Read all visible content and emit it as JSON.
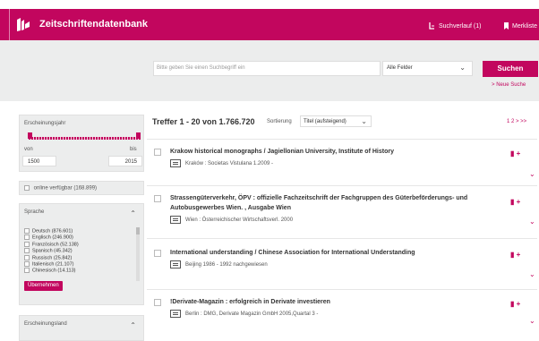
{
  "header": {
    "title": "Zeitschriftendatenbank",
    "history_label": "Suchverlauf (1)",
    "merkliste_label": "Merkliste"
  },
  "search": {
    "placeholder": "Bitte geben Sie einen Suchbegriff ein",
    "field_selected": "Alle Felder",
    "button_label": "Suchen",
    "new_search_label": "Neue Suche"
  },
  "filters": {
    "year": {
      "title": "Erscheinungsjahr",
      "from_label": "von",
      "to_label": "bis",
      "from_value": "1500",
      "to_value": "2015"
    },
    "online": {
      "label": "online verfügbar (168.899)"
    },
    "language": {
      "title": "Sprache",
      "items": [
        "Deutsch (876.601)",
        "Englisch (246.900)",
        "Französisch (52.138)",
        "Spanisch (45.342)",
        "Russisch (25.842)",
        "Italienisch (21.107)",
        "Chinesisch (14.113)"
      ],
      "apply_label": "Übernehmen"
    },
    "country": {
      "title": "Erscheinungsland"
    }
  },
  "results": {
    "summary": "Treffer 1 - 20  von 1.766.720",
    "sort_label": "Sortierung",
    "sort_value": "Titel (aufsteigend)",
    "pager": "1 2 >  >>",
    "items": [
      {
        "title": "Krakow historical monographs / Jagiellonian University, Institute of History",
        "info": "Kraków : Societas Vistulana 1.2009 -"
      },
      {
        "title": "Strassengüterverkehr, ÖPV : offizielle Fachzeitschrift der Fachgruppen des Güterbeförderungs- und Autobusgewerbes Wien. , Ausgabe Wien",
        "info": "Wien : Österreichischer Wirtschaftsverl. 2000"
      },
      {
        "title": "International understanding / Chinese Association for International Understanding",
        "info": "Beijing 1986 - 1992 nachgewiesen"
      },
      {
        "title": "!Derivate-Magazin : erfolgreich in Derivate investieren",
        "info": "Berlin : DMG, Derivate Magazin GmbH 2005,Quartal 3 -"
      }
    ]
  }
}
